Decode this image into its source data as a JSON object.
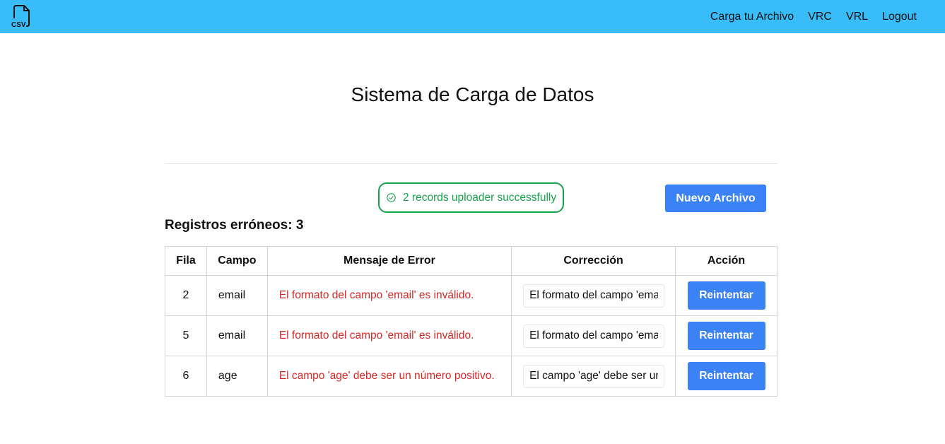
{
  "navbar": {
    "logo_icon": "csv-file-icon",
    "logo_text": "CSV",
    "links": [
      {
        "label": "Carga tu Archivo"
      },
      {
        "label": "VRC"
      },
      {
        "label": "VRL"
      },
      {
        "label": "Logout"
      }
    ],
    "background": "#38bdf8"
  },
  "main": {
    "title": "Sistema de Carga de Datos",
    "success_message": "2 records uploader successfully",
    "success_icon": "check-circle-icon",
    "new_file_label": "Nuevo Archivo",
    "errors_heading": "Registros erróneos: 3"
  },
  "table": {
    "headers": {
      "row": "Fila",
      "field": "Campo",
      "message": "Mensaje de Error",
      "correction": "Corrección",
      "action": "Acción"
    },
    "rows": [
      {
        "row": "2",
        "field": "email",
        "message": "El formato del campo 'email' es inválido.",
        "correction": "El formato del campo 'email' es inválido.",
        "action": "Reintentar"
      },
      {
        "row": "5",
        "field": "email",
        "message": "El formato del campo 'email' es inválido.",
        "correction": "El formato del campo 'email' es inválido.",
        "action": "Reintentar"
      },
      {
        "row": "6",
        "field": "age",
        "message": "El campo 'age' debe ser un número positivo.",
        "correction": "El campo 'age' debe ser un número positivo.",
        "action": "Reintentar"
      }
    ]
  },
  "colors": {
    "accent": "#3b82f6",
    "success": "#16a34a",
    "error": "#dc2626"
  }
}
